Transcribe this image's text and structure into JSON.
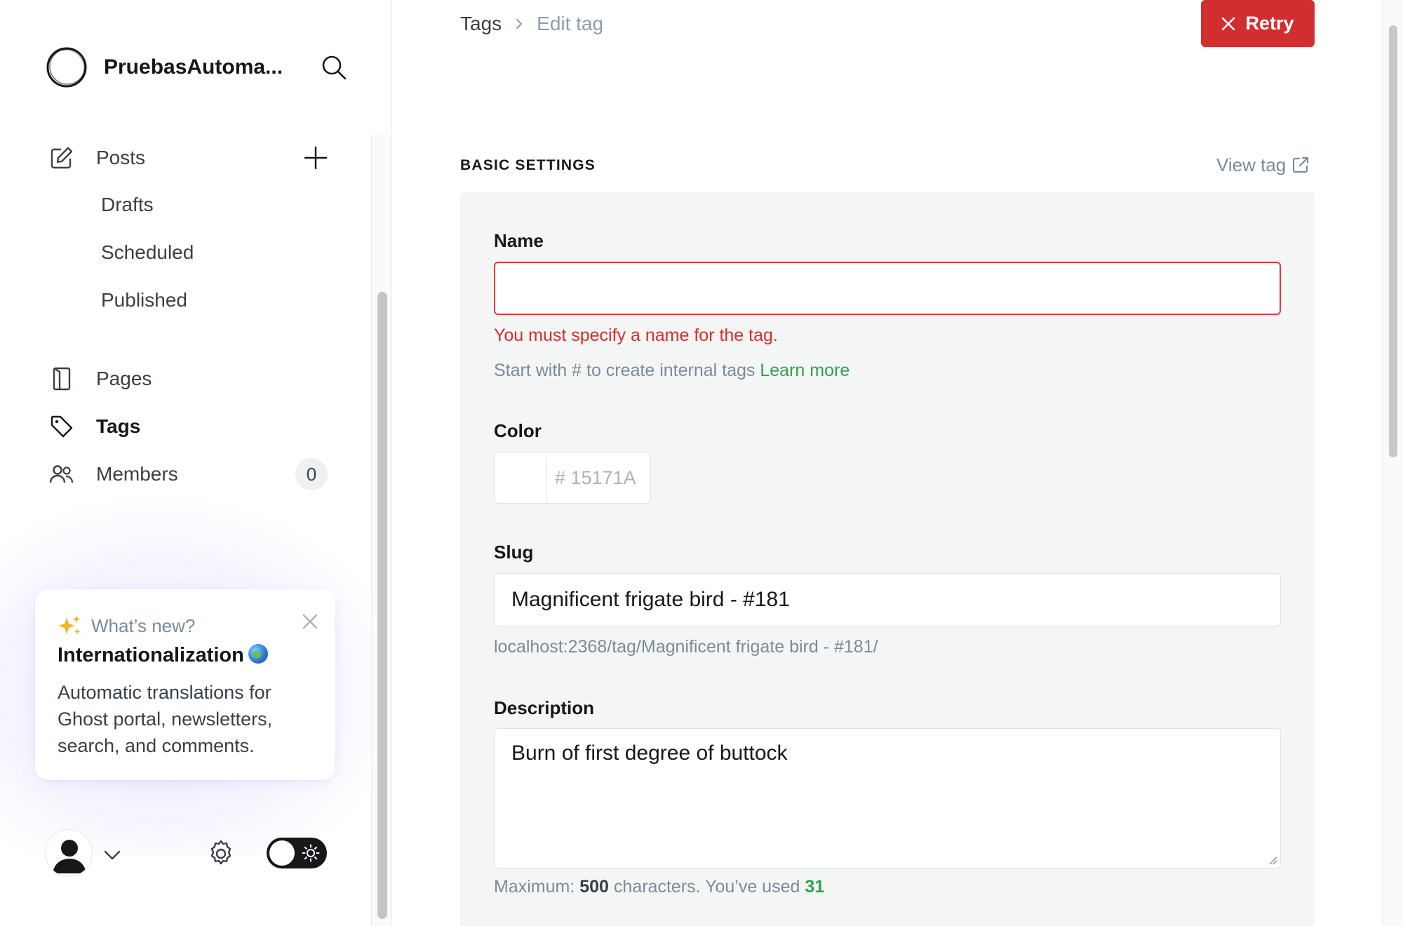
{
  "sidebar": {
    "site_name": "PruebasAutoma...",
    "nav": {
      "posts": "Posts",
      "drafts": "Drafts",
      "scheduled": "Scheduled",
      "published": "Published",
      "pages": "Pages",
      "tags": "Tags",
      "members": "Members",
      "members_count": "0"
    },
    "whats_new": {
      "label": "What’s new?",
      "title": "Internationalization",
      "text": "Automatic translations for Ghost portal, newsletters, search, and comments."
    }
  },
  "header": {
    "breadcrumb_root": "Tags",
    "breadcrumb_current": "Edit tag",
    "retry_label": "Retry"
  },
  "settings": {
    "section_title": "BASIC SETTINGS",
    "view_tag": "View tag",
    "name": {
      "label": "Name",
      "value": "",
      "error": "You must specify a name for the tag.",
      "hint": "Start with # to create internal tags",
      "hint_link": "Learn more"
    },
    "color": {
      "label": "Color",
      "hash": "#",
      "placeholder": "15171A"
    },
    "slug": {
      "label": "Slug",
      "value": "Magnificent frigate bird - #181",
      "url": "localhost:2368/tag/Magnificent frigate bird - #181/"
    },
    "description": {
      "label": "Description",
      "value": "Burn of first degree of buttock",
      "max_prefix": "Maximum:",
      "max_value": "500",
      "used_prefix": "characters. You’ve used",
      "used_value": "31"
    }
  },
  "colors": {
    "accent_error": "#d12f2f",
    "link_green": "#30a24b",
    "panel_bg": "#f4f5f5"
  },
  "icons": {
    "logo": "ring-logo-icon",
    "search": "search-icon",
    "posts": "pencil-square-icon",
    "add": "plus-icon",
    "pages": "page-icon",
    "tags": "tag-icon",
    "members": "users-icon",
    "sparkle": "sparkle-icon",
    "close": "close-icon",
    "chevron": "chevron-down-icon",
    "settings": "gear-icon",
    "theme": "sun-icon",
    "external": "external-link-icon"
  }
}
